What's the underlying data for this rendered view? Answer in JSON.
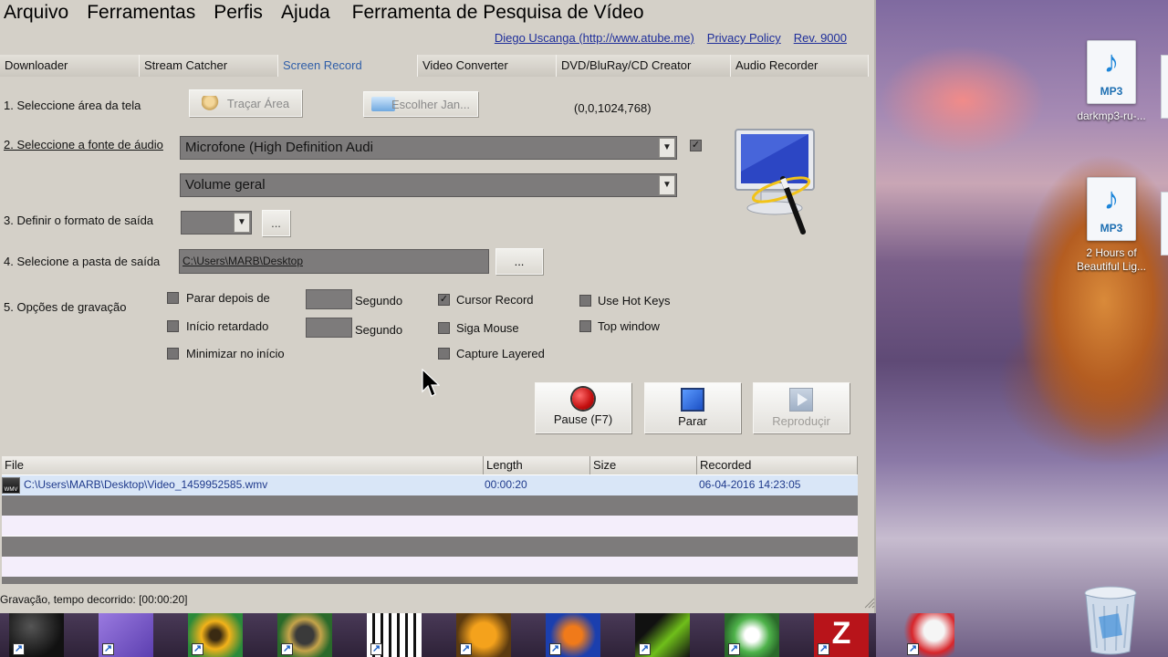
{
  "menu": [
    "Arquivo",
    "Ferramentas",
    "Perfis",
    "Ajuda",
    "Ferramenta de Pesquisa de Vídeo"
  ],
  "links": {
    "author": "Diego Uscanga (http://www.atube.me)",
    "privacy": "Privacy Policy",
    "rev": "Rev. 9000"
  },
  "tabs": [
    "Downloader",
    "Stream Catcher",
    "Screen Record",
    "Video Converter",
    "DVD/BluRay/CD Creator",
    "Audio Recorder"
  ],
  "active_tab": "Screen Record",
  "step1": {
    "label": "1. Seleccione área da tela",
    "draw_area_button": "Traçar Área",
    "choose_window_button": "Escolher Jan...",
    "coords": "(0,0,1024,768)"
  },
  "step2": {
    "label": "2. Seleccione a fonte de áudio",
    "audio_source": "Microfone (High Definition Audi",
    "volume": "Volume geral",
    "audio_enabled": "✓"
  },
  "step3": {
    "label": "3. Definir o formato de saída",
    "format_value": "",
    "more_button": "..."
  },
  "step4": {
    "label": "4. Selecione a pasta de saída",
    "folder": "C:\\Users\\MARB\\Desktop",
    "browse_button": "..."
  },
  "step5": {
    "label": "5. Opções de gravação",
    "stop_after": "Parar depois de",
    "delayed_start": "Início retardado",
    "minimize": "Minimizar no início",
    "seconds1": "Segundo",
    "seconds2": "Segundo",
    "cursor_record": "Cursor Record",
    "follow_mouse": "Siga Mouse",
    "capture_layered": "Capture Layered",
    "use_hot_keys": "Use Hot Keys",
    "top_window": "Top window",
    "cursor_record_checked": "✓"
  },
  "controls": {
    "pause": "Pause (F7)",
    "stop": "Parar",
    "play": "Reproduçir"
  },
  "list": {
    "headers": [
      "File",
      "Length",
      "Size",
      "Recorded"
    ],
    "rows": [
      {
        "file": "C:\\Users\\MARB\\Desktop\\Video_1459952585.wmv",
        "length": "00:00:20",
        "size": "",
        "recorded": "06-04-2016 14:23:05"
      }
    ]
  },
  "status": "Gravação, tempo decorrido: [00:00:20]",
  "desktop": {
    "icon1": {
      "type": "MP3",
      "caption": "darkmp3-ru-..."
    },
    "icon2": {
      "type": "MP3",
      "caption": "2 Hours of Beautiful Lig..."
    }
  },
  "colors": {
    "accent_tab": "#2f5ea8",
    "link": "#1e2e9a",
    "record": "#d11a1a",
    "stop": "#1b5fd6"
  }
}
